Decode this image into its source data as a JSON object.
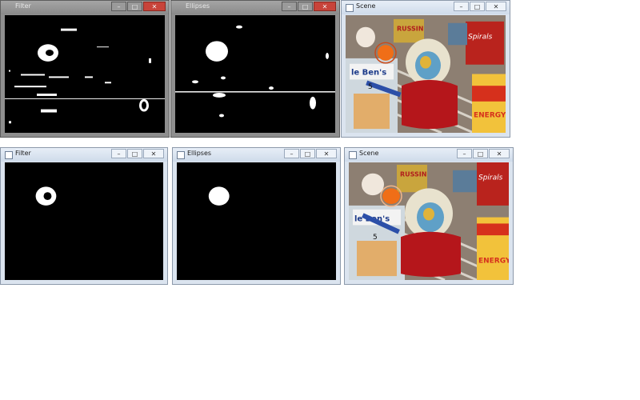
{
  "windows": {
    "filter_top": {
      "title": "Filter"
    },
    "ellipses_top": {
      "title": "Ellipses"
    },
    "scene_top": {
      "title": "Scene"
    },
    "filter_bot": {
      "title": "Filter"
    },
    "ellipses_bot": {
      "title": "Ellipses"
    },
    "scene_bot": {
      "title": "Scene"
    }
  },
  "buttons": {
    "minimize": "–",
    "maximize": "□",
    "close": "✕"
  },
  "scene": {
    "russian_box": "RUSSIN",
    "rice_box": "Uncle Ben's",
    "rice_box_small": "le Ben's",
    "spirals_box": "Spirals",
    "energy_can": "ENERGY",
    "number_badge": "5"
  },
  "icons": {
    "app": "window-app-icon",
    "minimize": "minimize-icon",
    "maximize": "maximize-icon",
    "close": "close-icon"
  }
}
